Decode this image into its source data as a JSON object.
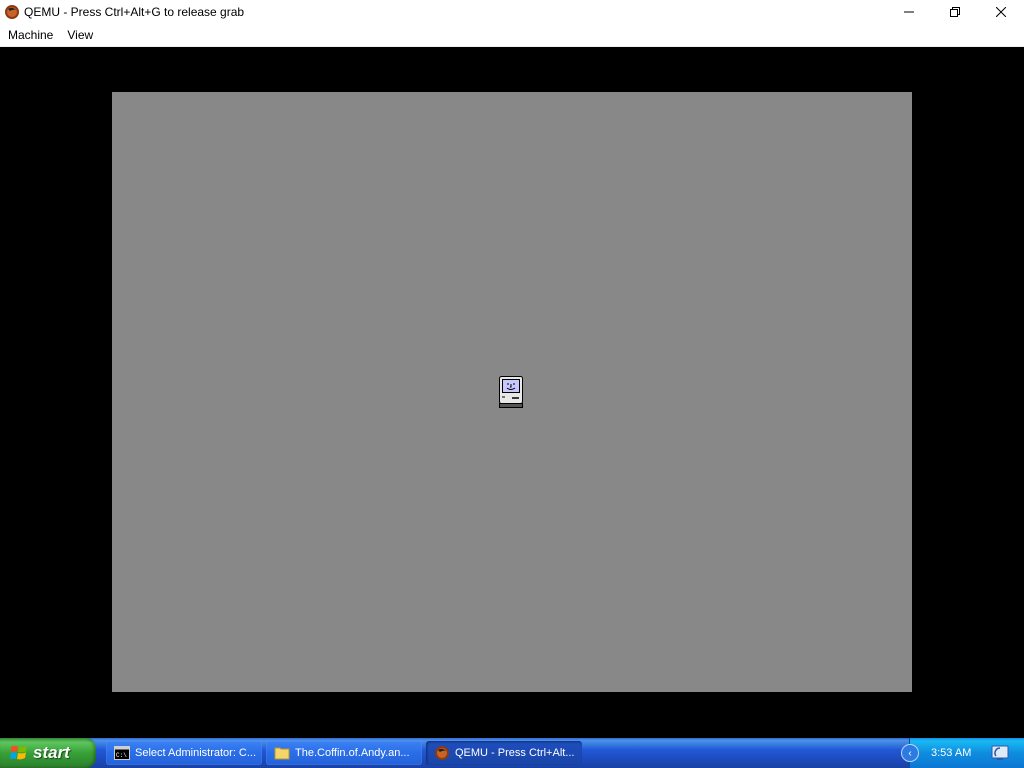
{
  "window": {
    "title": "QEMU - Press Ctrl+Alt+G to release grab",
    "controls": {
      "minimize": "—",
      "restore": "❐",
      "close": "✕"
    }
  },
  "menu": {
    "items": [
      {
        "label": "Machine"
      },
      {
        "label": "View"
      }
    ]
  },
  "emulator": {
    "screen_color": "#888888",
    "boot_icon": "happy-mac-icon"
  },
  "taskbar": {
    "start_label": "start",
    "tasks": [
      {
        "label": "Select Administrator: C...",
        "icon": "console-icon"
      },
      {
        "label": "The.Coffin.of.Andy.an...",
        "icon": "folder-icon"
      },
      {
        "label": "QEMU - Press Ctrl+Alt...",
        "icon": "qemu-icon",
        "active": true
      }
    ],
    "clock": "3:53 AM"
  },
  "colors": {
    "taskbar_blue": "#2157d7",
    "start_green": "#37a137",
    "tray_blue": "#0f8ce0"
  }
}
